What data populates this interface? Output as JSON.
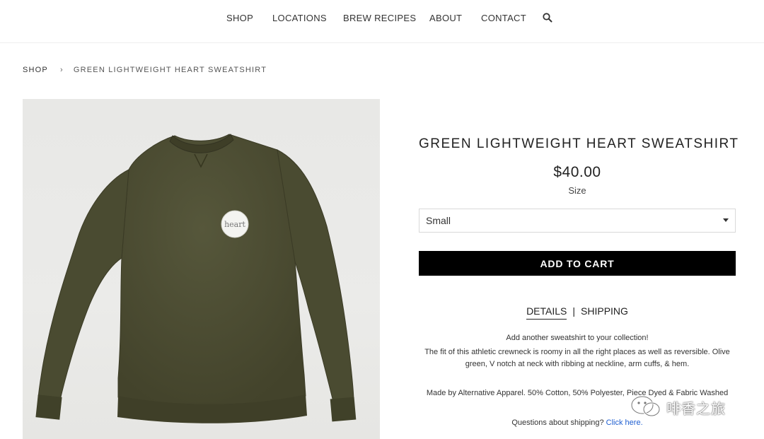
{
  "nav": {
    "items": [
      {
        "label": "SHOP"
      },
      {
        "label": "LOCATIONS"
      },
      {
        "label": "BREW RECIPES"
      },
      {
        "label": "ABOUT"
      },
      {
        "label": "CONTACT"
      }
    ],
    "search_icon": "search-icon"
  },
  "breadcrumb": {
    "root": "SHOP",
    "separator": "›",
    "current": "GREEN LIGHTWEIGHT HEART SWEATSHIRT"
  },
  "product": {
    "title": "GREEN LIGHTWEIGHT HEART SWEATSHIRT",
    "price": "$40.00",
    "size_label": "Size",
    "size_selected": "Small",
    "add_to_cart_label": "ADD TO CART",
    "patch_text": "heart",
    "garment_color": "#4a4a32"
  },
  "tabs": {
    "details_label": "DETAILS",
    "divider": "|",
    "shipping_label": "SHIPPING"
  },
  "description": {
    "line1": "Add another sweatshirt to your collection!",
    "line2": "The fit of this athletic crewneck is roomy in all the right places as well as reversible. Olive green, V notch at neck with ribbing at neckline, arm cuffs, & hem.",
    "line3": "Made by Alternative Apparel. 50% Cotton, 50% Polyester, Piece Dyed & Fabric Washed",
    "shipping_question": "Questions about shipping?",
    "shipping_link": "Click here."
  },
  "watermark": {
    "text": "啡香之旅"
  },
  "colors": {
    "accent_button": "#000000",
    "link": "#1f5fd1"
  }
}
